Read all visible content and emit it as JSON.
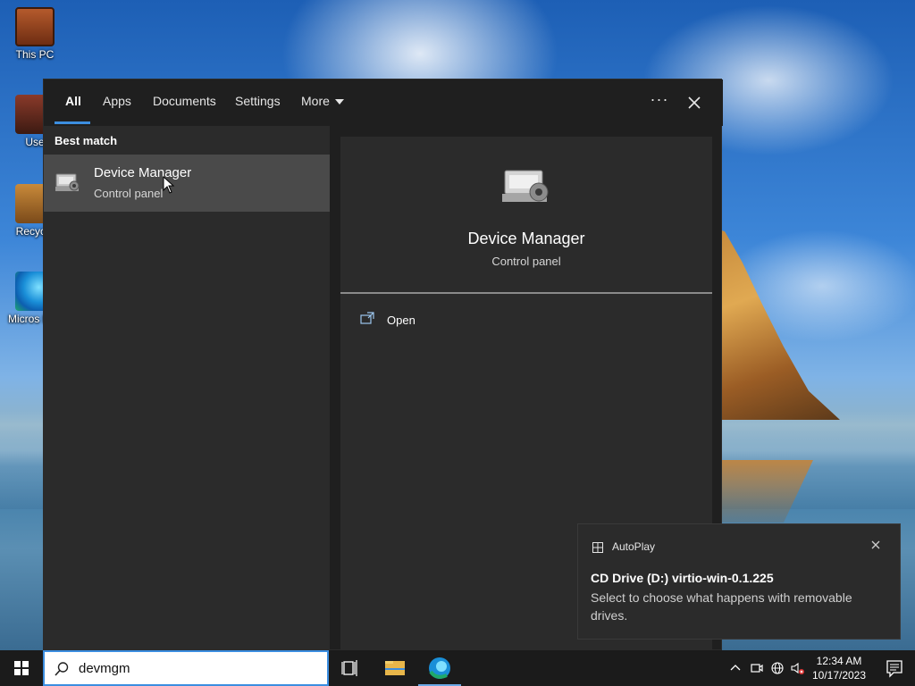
{
  "desktop": {
    "icons": [
      {
        "label": "This PC",
        "icon": "this-pc-icon"
      },
      {
        "label": "Use",
        "icon": "user-folder-icon"
      },
      {
        "label": "Recycle",
        "icon": "recycle-bin-icon"
      },
      {
        "label": "Micros Edg",
        "icon": "edge-icon"
      }
    ]
  },
  "search_panel": {
    "tabs": [
      {
        "label": "All",
        "active": true
      },
      {
        "label": "Apps"
      },
      {
        "label": "Documents"
      },
      {
        "label": "Settings"
      },
      {
        "label": "More"
      }
    ],
    "ellipsis_label": "···",
    "best_match_heading": "Best match",
    "result": {
      "title": "Device Manager",
      "subtitle": "Control panel",
      "icon": "device-manager-icon"
    },
    "preview": {
      "title": "Device Manager",
      "subtitle": "Control panel",
      "actions": [
        {
          "label": "Open",
          "icon": "open-external-icon"
        }
      ]
    }
  },
  "toast": {
    "app": "AutoPlay",
    "title": "CD Drive (D:) virtio-win-0.1.225",
    "body": "Select to choose what happens with removable drives."
  },
  "taskbar": {
    "search_query": "devmgm",
    "pinned": [
      {
        "name": "task-view-icon"
      },
      {
        "name": "file-explorer-icon"
      },
      {
        "name": "edge-icon",
        "active": true
      }
    ],
    "clock": {
      "time": "12:34 AM",
      "date": "10/17/2023"
    }
  },
  "colors": {
    "accent": "#3c8ee0",
    "panel_bg": "#1f1f1f",
    "column_bg": "#2b2b2b",
    "selected_row": "#4a4a4a"
  }
}
